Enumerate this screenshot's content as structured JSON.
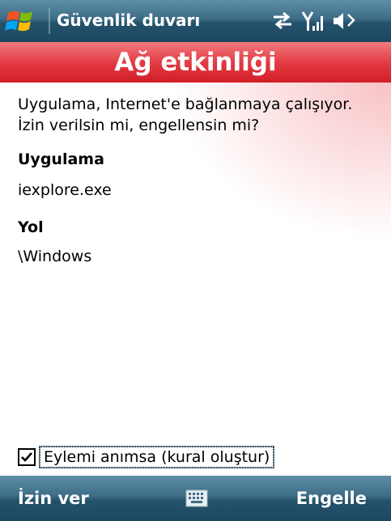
{
  "titlebar": {
    "title": "Güvenlik duvarı",
    "icons": [
      "windows-start-icon",
      "connectivity-icon",
      "signal-icon",
      "volume-icon"
    ]
  },
  "dialog": {
    "heading": "Ağ etkinliği",
    "message": "Uygulama, Internet'e bağlanmaya çalışıyor. İzin verilsin mi, engellensin mi?",
    "application_label": "Uygulama",
    "application_value": "iexplore.exe",
    "path_label": "Yol",
    "path_value": "\\Windows",
    "remember_label": "Eylemi anımsa (kural oluştur)",
    "remember_checked": true
  },
  "menubar": {
    "left_label": "İzin ver",
    "right_label": "Engelle",
    "center_icon": "keyboard-icon"
  },
  "colors": {
    "titlebar": "#3d6c86",
    "banner": "#e33c44",
    "text": "#000000"
  }
}
